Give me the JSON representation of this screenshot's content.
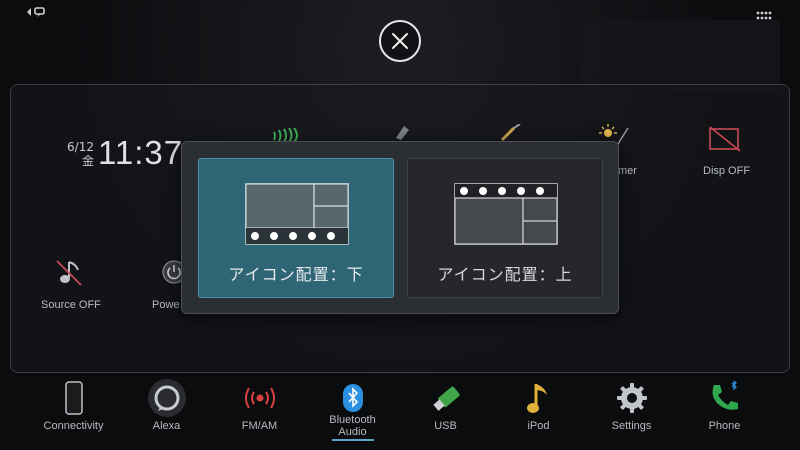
{
  "clock": {
    "date": "6/12",
    "weekday": "金",
    "time": "11:37"
  },
  "home_tiles": {
    "timer_label": "mer",
    "disp_off_label": "Disp OFF",
    "source_off_label": "Source OFF",
    "power_label": "Powe"
  },
  "modal": {
    "option_bottom_label": "アイコン配置：下",
    "option_top_label": "アイコン配置：上",
    "selected": "option_bottom"
  },
  "dock": {
    "items": [
      {
        "label": "Connectivity",
        "icon": "phone-device-icon"
      },
      {
        "label": "Alexa",
        "icon": "alexa-icon"
      },
      {
        "label": "FM/AM",
        "icon": "radio-icon"
      },
      {
        "label": "Bluetooth\nAudio",
        "label_line1": "Bluetooth",
        "label_line2": "Audio",
        "icon": "bluetooth-icon"
      },
      {
        "label": "USB",
        "icon": "usb-icon"
      },
      {
        "label": "iPod",
        "icon": "music-note-icon"
      },
      {
        "label": "Settings",
        "icon": "gear-icon"
      },
      {
        "label": "Phone",
        "icon": "phone-icon"
      }
    ],
    "active_index": 3
  },
  "colors": {
    "selected_option": "#2f6675",
    "accent": "#5aa6c4",
    "radio_red": "#d94040",
    "usb_green": "#3fa44a",
    "ipod_gold": "#e0b23a",
    "phone_green": "#2fa84f",
    "bluetooth_blue": "#2a8fe0"
  }
}
